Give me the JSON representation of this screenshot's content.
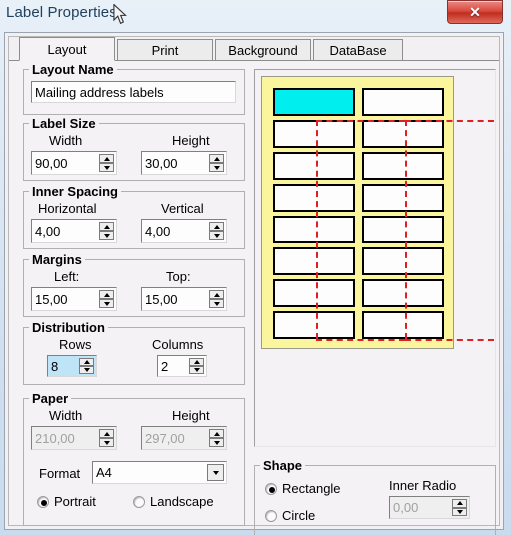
{
  "window": {
    "title": "Label Properties",
    "close_label": "✕"
  },
  "tabs": [
    {
      "label": "Layout",
      "active": true
    },
    {
      "label": "Print",
      "active": false
    },
    {
      "label": "Background",
      "active": false
    },
    {
      "label": "DataBase",
      "active": false
    }
  ],
  "groups": {
    "layout_name": {
      "title": "Layout Name",
      "value": "Mailing address labels"
    },
    "label_size": {
      "title": "Label Size",
      "width_label": "Width",
      "width_value": "90,00",
      "height_label": "Height",
      "height_value": "30,00"
    },
    "inner_spacing": {
      "title": "Inner Spacing",
      "horizontal_label": "Horizontal",
      "horizontal_value": "4,00",
      "vertical_label": "Vertical",
      "vertical_value": "4,00"
    },
    "margins": {
      "title": "Margins",
      "left_label": "Left:",
      "left_value": "15,00",
      "top_label": "Top:",
      "top_value": "15,00"
    },
    "distribution": {
      "title": "Distribution",
      "rows_label": "Rows",
      "rows_value": "8",
      "columns_label": "Columns",
      "columns_value": "2"
    },
    "paper": {
      "title": "Paper",
      "width_label": "Width",
      "width_value": "210,00",
      "height_label": "Height",
      "height_value": "297,00",
      "format_label": "Format",
      "format_value": "A4",
      "portrait_label": "Portrait",
      "landscape_label": "Landscape",
      "orientation": "Portrait"
    },
    "shape": {
      "title": "Shape",
      "rectangle_label": "Rectangle",
      "circle_label": "Circle",
      "selected": "Rectangle",
      "inner_radio_label": "Inner Radio",
      "inner_radio_value": "0,00"
    }
  },
  "preview": {
    "paper_color": "#fbf59d",
    "selected_cell_color": "#00eeee",
    "guide_color": "#e02020",
    "rows": 8,
    "columns": 2,
    "selected_row": 1,
    "selected_column": 1
  }
}
